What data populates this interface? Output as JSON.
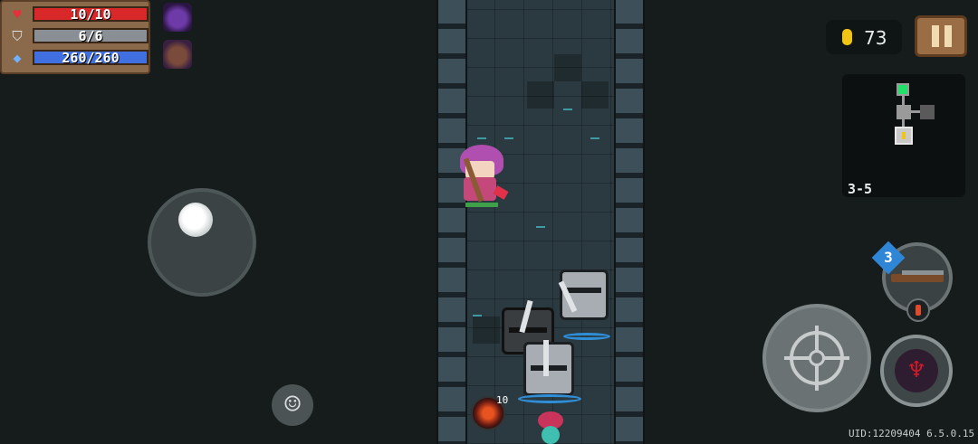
{
  "hud": {
    "hp": "10/10",
    "armor": "6/6",
    "energy": "260/260",
    "coins": "73",
    "floor": "3-5"
  },
  "icons": {
    "hp": "heart-icon",
    "armor": "shield-icon",
    "energy": "diamond-icon",
    "coin": "coin-icon",
    "pause": "pause-icon",
    "emote": "smile-icon",
    "fire": "crosshair-icon",
    "skill": "skill-icon",
    "weapon": "shotgun-icon",
    "potion": "potion-icon"
  },
  "weapon": {
    "energy_cost": "3"
  },
  "debuff": {
    "count": "10"
  },
  "footer": {
    "uid": "UID:12209404 6.5.0.15"
  },
  "colors": {
    "hp": "#d8282a",
    "armor": "#8a8f95",
    "energy": "#3f6fe0",
    "coin": "#f2c515",
    "minimap_current": "#22e06a"
  }
}
